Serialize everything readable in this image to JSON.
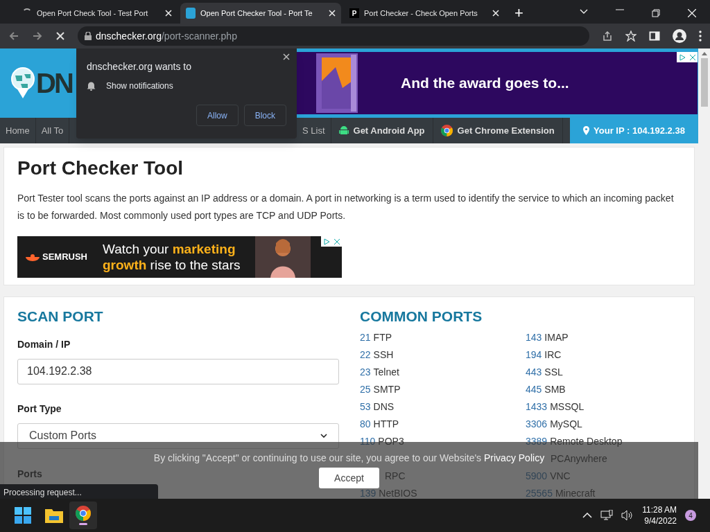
{
  "tabs": [
    {
      "title": "Open Port Check Tool - Test Port",
      "selected": false,
      "kind": "loading"
    },
    {
      "title": "Open Port Checker Tool - Port Te",
      "selected": true,
      "kind": "site"
    },
    {
      "title": "Port Checker - Check Open Ports",
      "selected": false,
      "kind": "letter",
      "letter": "P"
    }
  ],
  "new_tab": "+",
  "address": {
    "domain": "dnschecker.org",
    "path": "/port-scanner.php"
  },
  "permission_prompt": {
    "title": "dnschecker.org wants to",
    "request": "Show notifications",
    "buttons": [
      "Allow",
      "Block"
    ]
  },
  "header": {
    "logo": "DN",
    "ad_text": "And the award goes to..."
  },
  "nav": {
    "items": [
      {
        "label": "Home",
        "kind": "text"
      },
      {
        "label": "All To",
        "kind": "text"
      },
      {
        "label": "S List",
        "kind": "text"
      },
      {
        "label": "Get Android App",
        "kind": "android"
      },
      {
        "label": "Get Chrome Extension",
        "kind": "chrome"
      }
    ],
    "ip": "Your IP : 104.192.2.38"
  },
  "intro": {
    "title": "Port Checker Tool",
    "text": "Port Tester tool scans the ports against an IP address or a domain. A port in networking is a term used to identify the service to which an incoming packet is to be forwarded. Most commonly used port types are TCP and UDP Ports.",
    "ad": {
      "brand": "SEMRUSH",
      "text": "Watch your **marketing** **growth** rise to the stars"
    }
  },
  "scan": {
    "title": "SCAN PORT",
    "domain_label": "Domain / IP",
    "domain_value": "104.192.2.38",
    "type_label": "Port Type",
    "type_value": "Custom Ports",
    "ports_label": "Ports"
  },
  "common": {
    "title": "COMMON PORTS",
    "left": [
      {
        "num": "21",
        "name": "FTP"
      },
      {
        "num": "22",
        "name": "SSH"
      },
      {
        "num": "23",
        "name": "Telnet"
      },
      {
        "num": "25",
        "name": "SMTP"
      },
      {
        "num": "53",
        "name": "DNS"
      },
      {
        "num": "80",
        "name": "HTTP"
      },
      {
        "num": "110",
        "name": "POP3"
      },
      {
        "name": "RPC",
        "gap_before": true
      },
      {
        "num": "139",
        "name": "NetBIOS"
      }
    ],
    "right": [
      {
        "num": "143",
        "name": "IMAP"
      },
      {
        "num": "194",
        "name": "IRC"
      },
      {
        "num": "443",
        "name": "SSL"
      },
      {
        "num": "445",
        "name": "SMB"
      },
      {
        "num": "1433",
        "name": "MSSQL"
      },
      {
        "num": "3306",
        "name": "MySQL"
      },
      {
        "num": "3389",
        "name": "Remote Desktop"
      },
      {
        "name": "PCAnywhere"
      },
      {
        "num": "5900",
        "name": "VNC"
      },
      {
        "num": "25565",
        "name": "Minecraft"
      }
    ]
  },
  "cookie": {
    "text": "By clicking \"Accept\" or continuing to use our site, you agree to our Website's **Privacy Policy**",
    "button": "Accept"
  },
  "status": "Processing request...",
  "taskbar": {
    "time": "11:28 AM",
    "date": "9/4/2022",
    "badge": "4"
  }
}
